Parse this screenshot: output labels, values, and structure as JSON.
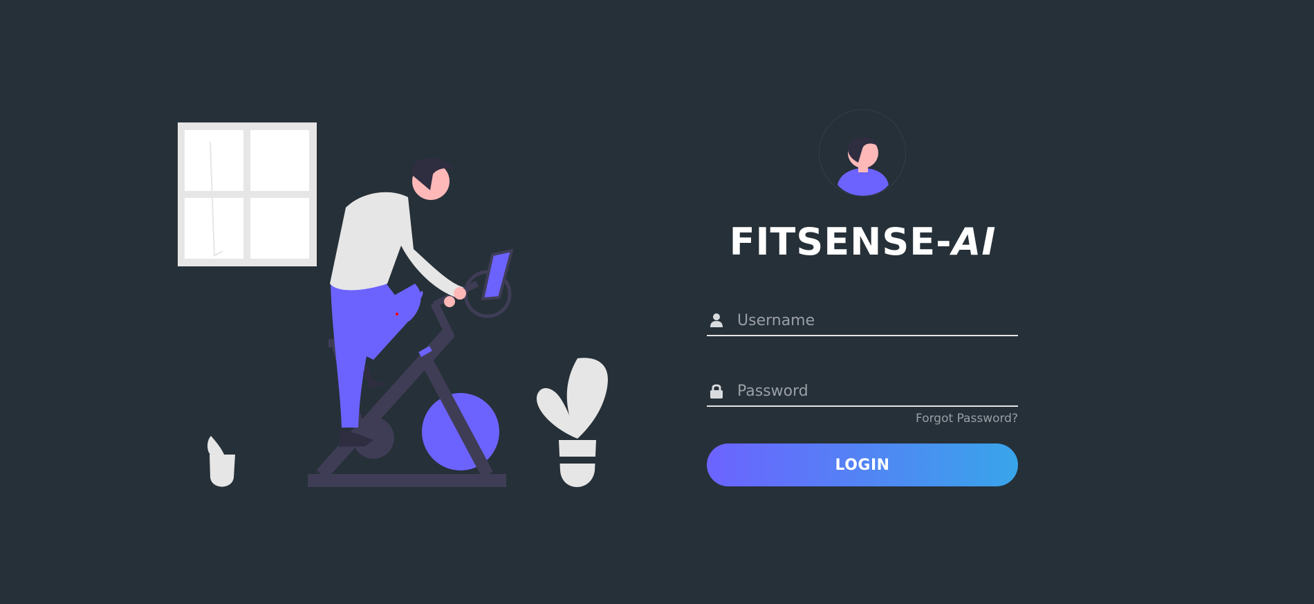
{
  "app": {
    "title_main": "FITSENSE-",
    "title_suffix": "AI"
  },
  "form": {
    "username_placeholder": "Username",
    "username_value": "",
    "password_placeholder": "Password",
    "password_value": "",
    "forgot_label": "Forgot Password?",
    "login_label": "LOGIN"
  },
  "icons": {
    "username": "user-icon",
    "password": "lock-icon"
  },
  "colors": {
    "background": "#263038",
    "accent_purple": "#6c63ff",
    "accent_blue": "#38a5ea",
    "dark_frame": "#3f3d56",
    "light_gray": "#e6e6e6",
    "skin": "#ffb8b8",
    "hair": "#2f2e41",
    "muted_text": "#9a9fa6"
  }
}
